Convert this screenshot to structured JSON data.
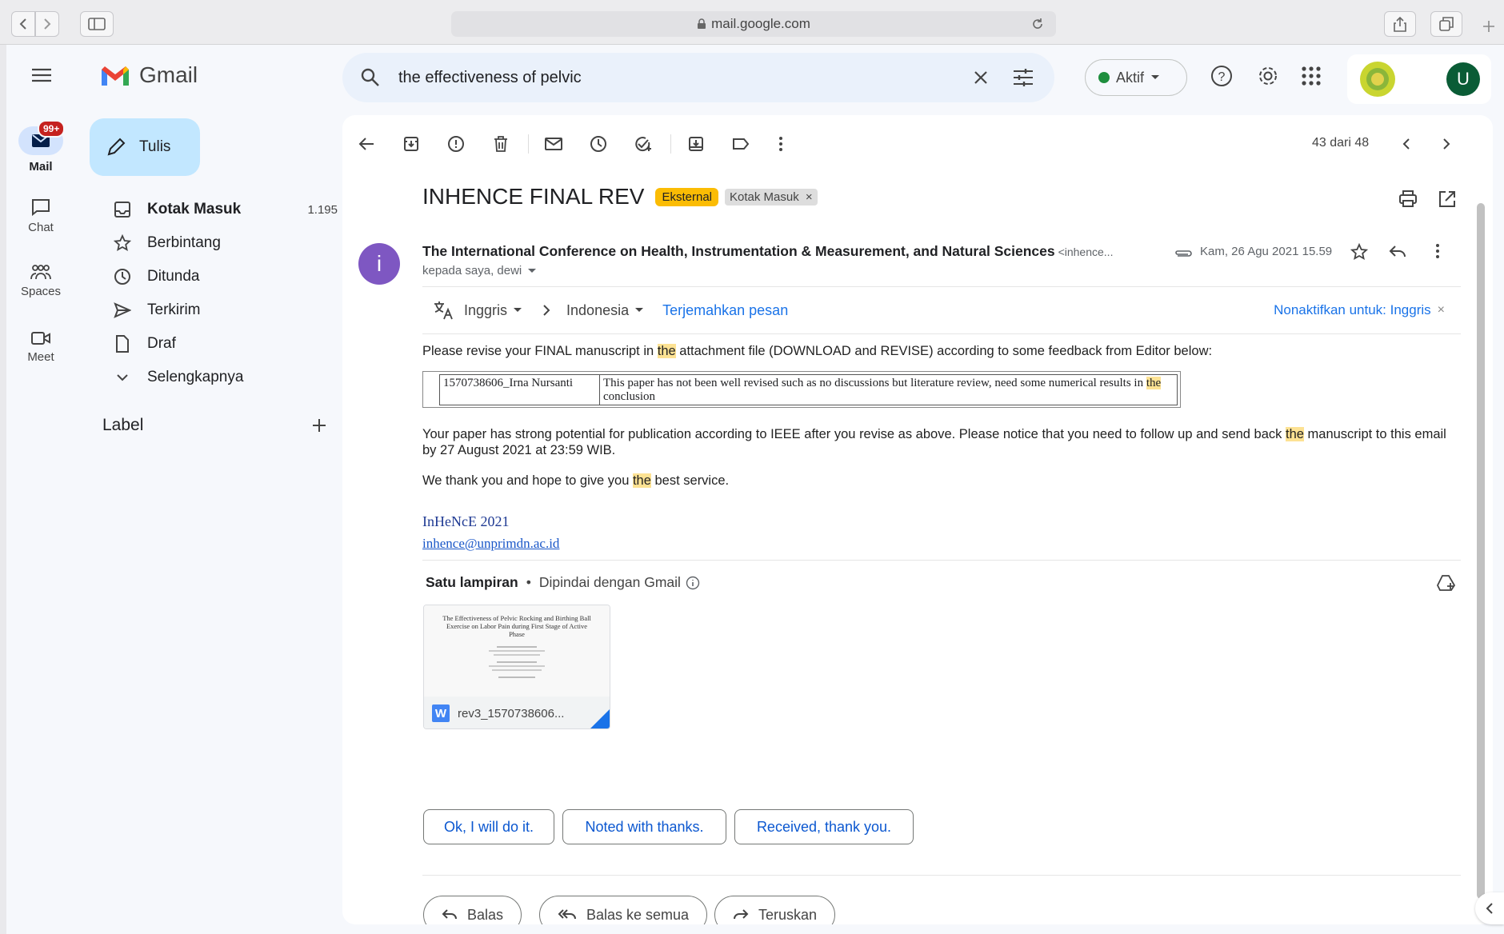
{
  "browser": {
    "url": "mail.google.com"
  },
  "app": {
    "name": "Gmail"
  },
  "search": {
    "query": "the effectiveness of pelvic"
  },
  "status": {
    "label": "Aktif",
    "color": "#1e8e3e"
  },
  "user": {
    "avatar_letter": "U"
  },
  "rail": {
    "mail_badge": "99+",
    "items": [
      {
        "label": "Mail"
      },
      {
        "label": "Chat"
      },
      {
        "label": "Spaces"
      },
      {
        "label": "Meet"
      }
    ]
  },
  "compose": {
    "label": "Tulis"
  },
  "nav": [
    {
      "label": "Kotak Masuk",
      "count": "1.195",
      "icon": "inbox-icon"
    },
    {
      "label": "Berbintang",
      "count": "",
      "icon": "star-icon"
    },
    {
      "label": "Ditunda",
      "count": "",
      "icon": "clock-icon"
    },
    {
      "label": "Terkirim",
      "count": "",
      "icon": "send-icon"
    },
    {
      "label": "Draf",
      "count": "",
      "icon": "draft-icon"
    },
    {
      "label": "Selengkapnya",
      "count": "",
      "icon": "chevron-down-icon"
    }
  ],
  "labels": {
    "title": "Label"
  },
  "pager": {
    "text": "43 dari 48"
  },
  "email": {
    "subject": "INHENCE FINAL REV",
    "tag_external": "Eksternal",
    "tag_inbox": "Kotak Masuk",
    "sender_name": "The International Conference on Health, Instrumentation & Measurement, and Natural Sciences",
    "sender_email": "<inhence...",
    "date": "Kam, 26 Agu 2021 15.59",
    "recipients": "kepada saya, dewi",
    "translate": {
      "from": "Inggris",
      "to": "Indonesia",
      "action": "Terjemahkan pesan",
      "disable": "Nonaktifkan untuk: Inggris"
    },
    "p1_a": "Please revise your FINAL manuscript in ",
    "p1_hl": "the",
    "p1_b": " attachment file (DOWNLOAD and REVISE) according to some feedback from Editor below:",
    "table": {
      "id": "1570738606_Irna Nursanti",
      "feedback_a": "This paper has not been well revised such as no discussions but literature review, need some numerical results in ",
      "feedback_hl": "the",
      "feedback_b": " conclusion"
    },
    "p2_a": "Your paper has strong potential for publication according to IEEE after you revise as above. Please notice that you need to follow up and send back ",
    "p2_hl": "the",
    "p2_b": " manuscript to this email by 27 August 2021 at 23:59 WIB.",
    "p3_a": "We thank you and hope to give you ",
    "p3_hl": "the",
    "p3_b": " best service.",
    "sig_name": "InHeNcE 2021",
    "sig_email": "inhence@unprimdn.ac.id"
  },
  "attachment": {
    "header": "Satu lampiran",
    "scanned": "Dipindai dengan Gmail",
    "filename": "rev3_1570738606...",
    "thumb_title": "The Effectiveness of Pelvic Rocking and Birthing Ball Exercise on Labor Pain during First Stage of Active Phase"
  },
  "smart_replies": [
    "Ok, I will do it.",
    "Noted with thanks.",
    "Received, thank you."
  ],
  "actions": {
    "reply": "Balas",
    "reply_all": "Balas ke semua",
    "forward": "Teruskan"
  }
}
